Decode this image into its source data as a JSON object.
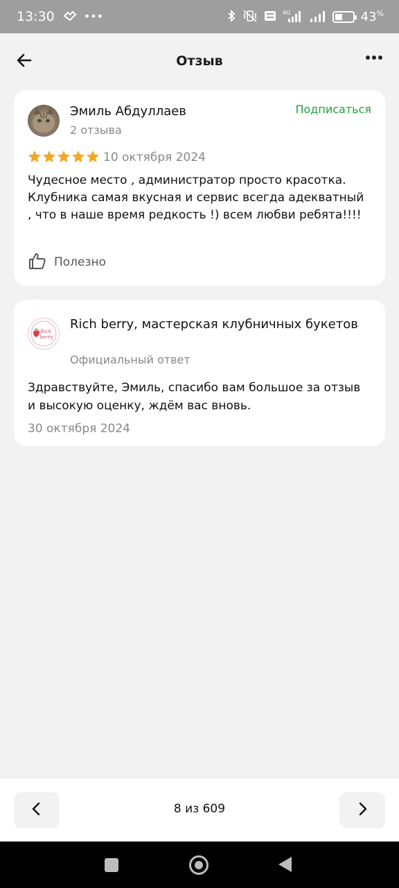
{
  "status_bar": {
    "time": "13:30",
    "network": "4G",
    "battery_percent_label": "43",
    "battery_percent_sign": "%",
    "battery_level": 0.43
  },
  "header": {
    "title": "Отзыв"
  },
  "review": {
    "author": "Эмиль Абдуллаев",
    "author_reviews": "2 отзыва",
    "subscribe_label": "Подписаться",
    "rating": 5,
    "date": "10 октября 2024",
    "text": "Чудесное место , администратор просто красотка. Клубника самая вкусная и сервис всегда адекватный , что в наше время редкость !) всем любви ребята!!!!",
    "useful_label": "Полезно"
  },
  "reply": {
    "business_name": "Rich berry, мастерская клубничных букетов",
    "logo_text": "Rich berry",
    "subtitle": "Официальный ответ",
    "text": "Здравствуйте, Эмиль, спасибо вам большое за отзыв и высокую оценку, ждём вас вновь.",
    "date": "30 октября 2024"
  },
  "pager": {
    "label": "8 из 609"
  },
  "colors": {
    "accent_green": "#21a038",
    "star": "#f5a623",
    "status_bar": "#9e9e9e"
  }
}
